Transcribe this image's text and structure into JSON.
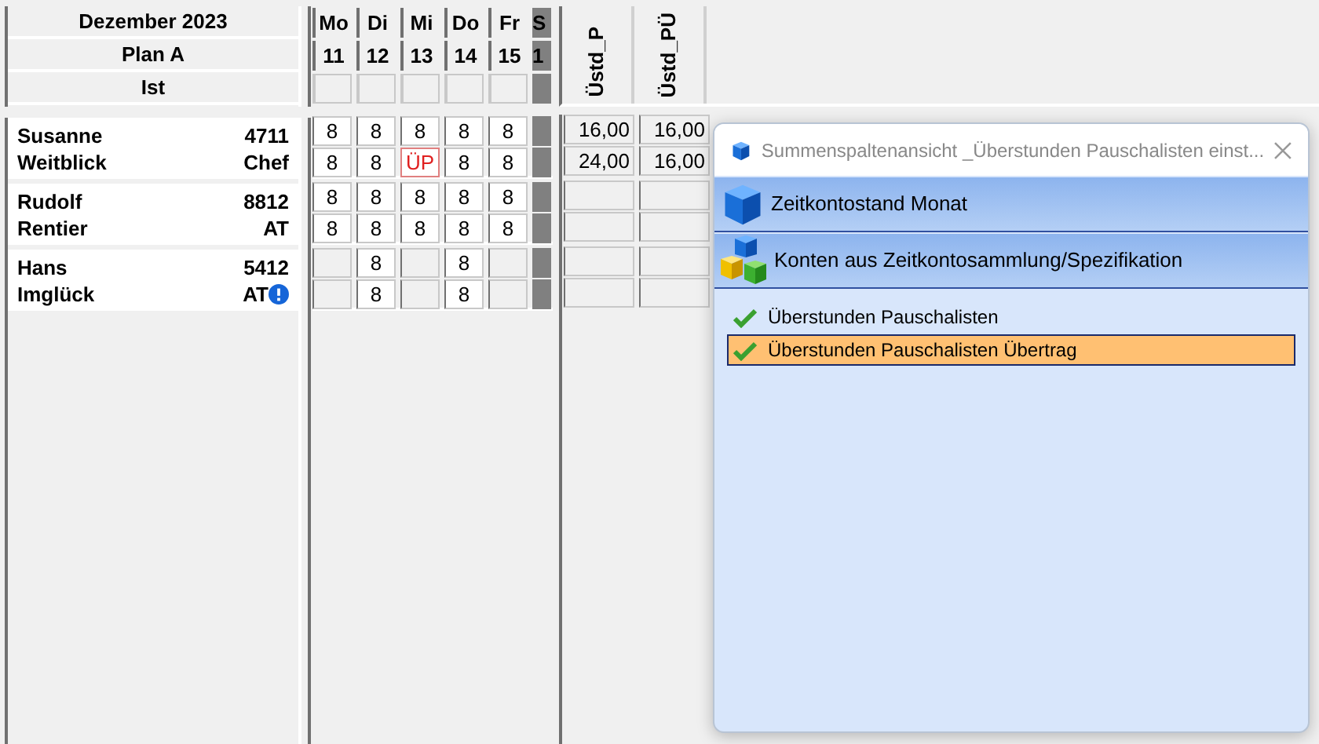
{
  "header": {
    "month": "Dezember 2023",
    "plan": "Plan A",
    "actual": "Ist"
  },
  "days": [
    {
      "name": "Mo",
      "date": "11",
      "weekend": false
    },
    {
      "name": "Di",
      "date": "12",
      "weekend": false
    },
    {
      "name": "Mi",
      "date": "13",
      "weekend": false
    },
    {
      "name": "Do",
      "date": "14",
      "weekend": false
    },
    {
      "name": "Fr",
      "date": "15",
      "weekend": false
    },
    {
      "name": "S",
      "date": "1",
      "weekend": true
    }
  ],
  "sum_columns": [
    "Üstd_P",
    "Üstd_PÜ"
  ],
  "employees": [
    {
      "first_name": "Susanne",
      "last_name": "Weitblick",
      "number": "4711",
      "type": "Chef",
      "warning": false,
      "rows": [
        {
          "cells": [
            {
              "kind": "hours",
              "value": "8"
            },
            {
              "kind": "hours",
              "value": "8"
            },
            {
              "kind": "hours",
              "value": "8"
            },
            {
              "kind": "hours",
              "value": "8"
            },
            {
              "kind": "hours",
              "value": "8"
            },
            {
              "kind": "weekend"
            }
          ],
          "sums": [
            "16,00",
            "16,00"
          ]
        },
        {
          "cells": [
            {
              "kind": "hours",
              "value": "8"
            },
            {
              "kind": "hours",
              "value": "8"
            },
            {
              "kind": "code",
              "value": "ÜP"
            },
            {
              "kind": "hours",
              "value": "8"
            },
            {
              "kind": "hours",
              "value": "8"
            },
            {
              "kind": "weekend"
            }
          ],
          "sums": [
            "24,00",
            "16,00"
          ]
        }
      ]
    },
    {
      "first_name": "Rudolf",
      "last_name": "Rentier",
      "number": "8812",
      "type": "AT",
      "warning": false,
      "rows": [
        {
          "cells": [
            {
              "kind": "hours",
              "value": "8"
            },
            {
              "kind": "hours",
              "value": "8"
            },
            {
              "kind": "hours",
              "value": "8"
            },
            {
              "kind": "hours",
              "value": "8"
            },
            {
              "kind": "hours",
              "value": "8"
            },
            {
              "kind": "weekend"
            }
          ],
          "sums": []
        },
        {
          "cells": [
            {
              "kind": "hours",
              "value": "8"
            },
            {
              "kind": "hours",
              "value": "8"
            },
            {
              "kind": "hours",
              "value": "8"
            },
            {
              "kind": "hours",
              "value": "8"
            },
            {
              "kind": "hours",
              "value": "8"
            },
            {
              "kind": "weekend"
            }
          ],
          "sums": []
        }
      ]
    },
    {
      "first_name": "Hans",
      "last_name": "Imglück",
      "number": "5412",
      "type": "AT",
      "warning": true,
      "rows": [
        {
          "cells": [
            {
              "kind": "empty"
            },
            {
              "kind": "hours",
              "value": "8"
            },
            {
              "kind": "empty"
            },
            {
              "kind": "hours",
              "value": "8"
            },
            {
              "kind": "empty"
            },
            {
              "kind": "weekend"
            }
          ],
          "sums": []
        },
        {
          "cells": [
            {
              "kind": "empty"
            },
            {
              "kind": "hours",
              "value": "8"
            },
            {
              "kind": "empty"
            },
            {
              "kind": "hours",
              "value": "8"
            },
            {
              "kind": "empty"
            },
            {
              "kind": "weekend"
            }
          ],
          "sums": []
        }
      ]
    }
  ],
  "dialog": {
    "title": "Summenspaltenansicht _Überstunden Pauschalisten einst...",
    "sections": [
      {
        "kind": "cube",
        "label": "Zeitkontostand Monat"
      },
      {
        "kind": "cubes",
        "label": "Konten aus Zeitkontosammlung/Spezifikation"
      }
    ],
    "items": [
      {
        "label": "Überstunden Pauschalisten",
        "checked": true,
        "selected": false
      },
      {
        "label": "Überstunden Pauschalisten Übertrag",
        "checked": true,
        "selected": true
      }
    ]
  }
}
